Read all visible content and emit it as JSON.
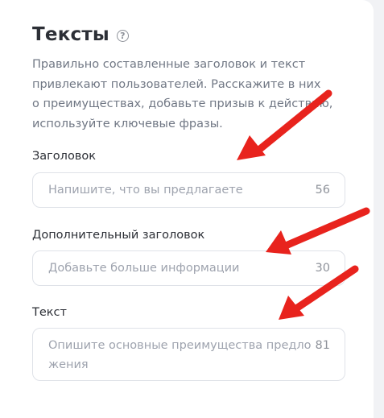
{
  "section": {
    "title": "Тексты",
    "help_icon_glyph": "?",
    "description": "Правильно составленные заголовок и текст\nпривлекают пользователей. Расскажите в них\nо преимуществах, добавьте призыв к действию,\nиспользуйте ключевые фразы."
  },
  "fields": {
    "headline": {
      "label": "Заголовок",
      "placeholder": "Напишите, что вы предлагаете",
      "counter": "56"
    },
    "subheadline": {
      "label": "Дополнительный заголовок",
      "placeholder": "Добавьте больше информации",
      "counter": "30"
    },
    "text": {
      "label": "Текст",
      "placeholder_line1": "Опишите основные преимущества предло",
      "placeholder_line2": "жения",
      "counter": "81"
    }
  },
  "annotations": {
    "arrow_color": "#e8231d",
    "icon": "red-arrow-icon"
  }
}
